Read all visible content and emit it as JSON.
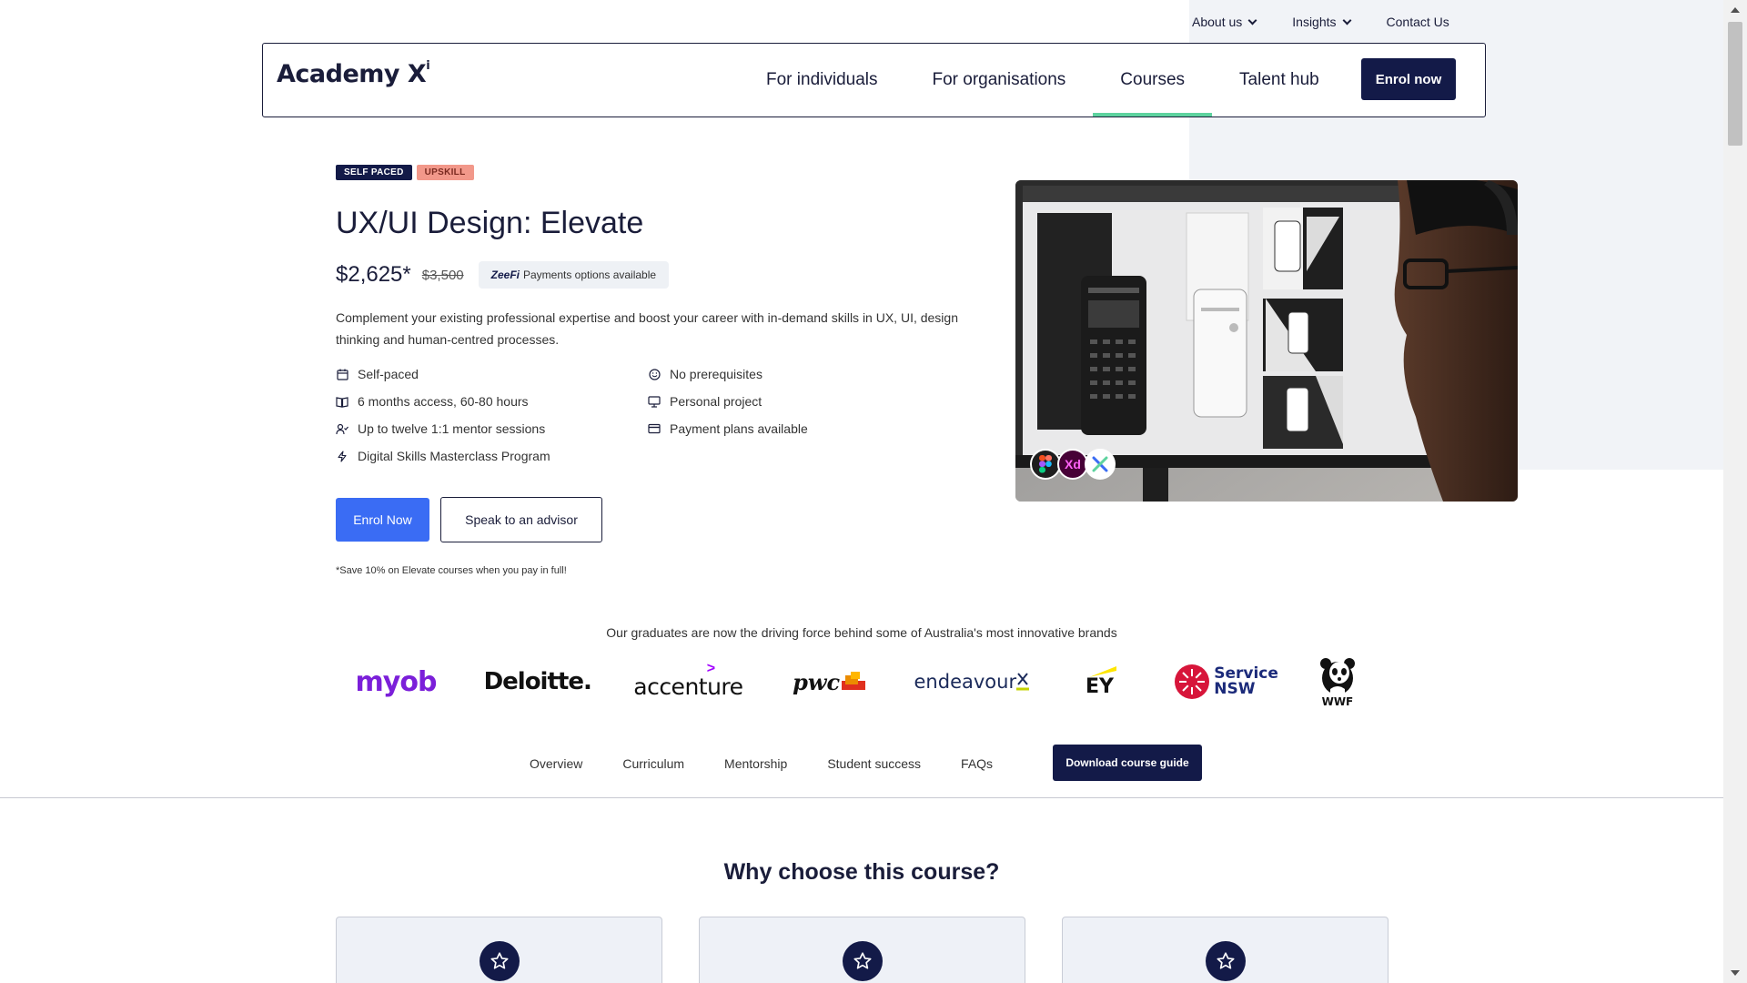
{
  "utility_nav": {
    "about": "About us",
    "insights": "Insights",
    "contact": "Contact Us"
  },
  "header": {
    "logo_text": "Academy X",
    "logo_sup": "i",
    "nav": [
      "For individuals",
      "For organisations",
      "Courses",
      "Talent hub"
    ],
    "active_nav": "Courses",
    "enrol_label": "Enrol now"
  },
  "hero": {
    "badges": [
      "SELF PACED",
      "UPSKILL"
    ],
    "title": "UX/UI Design: Elevate",
    "price": "$2,625*",
    "old_price": "$3,500",
    "payments_brand": "ZeeFi",
    "payments_text": "Payments options available",
    "description": "Complement your existing professional expertise and boost your career with in-demand skills in UX, UI, design thinking and human-centred processes.",
    "features": [
      {
        "icon": "calendar-icon",
        "text": "Self-paced"
      },
      {
        "icon": "smile-icon",
        "text": "No prerequisites"
      },
      {
        "icon": "book-icon",
        "text": "6 months access, 60-80 hours"
      },
      {
        "icon": "monitor-icon",
        "text": "Personal project"
      },
      {
        "icon": "user-check-icon",
        "text": "Up to twelve 1:1 mentor sessions"
      },
      {
        "icon": "credit-card-icon",
        "text": "Payment plans available"
      },
      {
        "icon": "lightning-icon",
        "text": "Digital Skills Masterclass Program"
      }
    ],
    "enrol_button": "Enrol Now",
    "advisor_button": "Speak to an advisor",
    "footnote": "*Save 10% on Elevate courses when you pay in full!",
    "tool_icons": [
      "figma-icon",
      "xd-icon",
      "academy-x-icon"
    ],
    "tool_xd_label": "Xd"
  },
  "brands": {
    "caption": "Our graduates are now the driving force behind some of Australia's most innovative brands",
    "logos": [
      "myob",
      "Deloitte.",
      "accenture",
      "pwc",
      "endeavour",
      "EY",
      "Service NSW",
      "WWF"
    ]
  },
  "tabs": {
    "items": [
      "Overview",
      "Curriculum",
      "Mentorship",
      "Student success",
      "FAQs"
    ],
    "download": "Download course guide"
  },
  "why": {
    "title": "Why choose this course?",
    "card_icon": "star-icon"
  },
  "colors": {
    "navy": "#131a48",
    "primary_blue": "#3a6cf4",
    "coral": "#f2988a",
    "active_underline": "#5ed39f"
  }
}
